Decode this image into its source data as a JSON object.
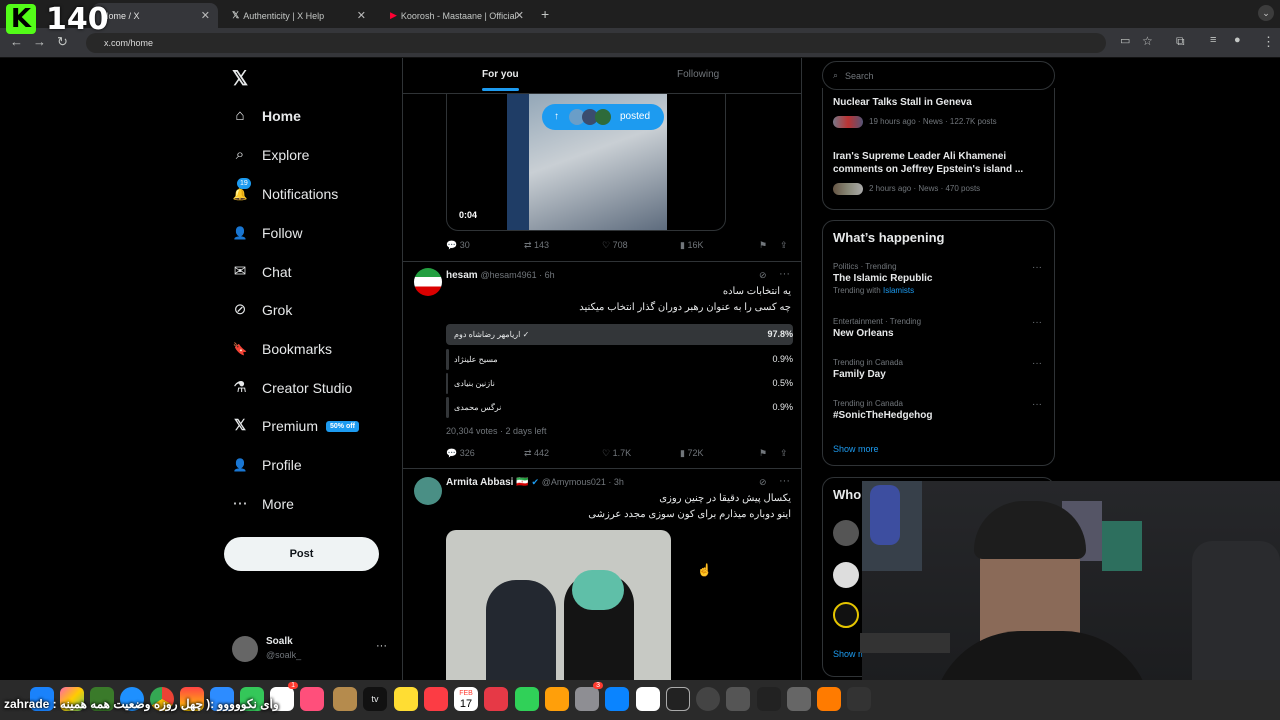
{
  "overlay": {
    "logo": "K",
    "viewers": "140"
  },
  "browser": {
    "tabs": [
      {
        "title": "Home / X",
        "active": true
      },
      {
        "title": "Authenticity | X Help",
        "active": false
      },
      {
        "title": "Koorosh - Mastaane | Official",
        "active": false
      }
    ],
    "new_tab": "+",
    "url": "x.com/home"
  },
  "sidebar": {
    "logo": "𝕏",
    "items": [
      {
        "label": "Home",
        "icon": "home-icon",
        "glyph": "⌂"
      },
      {
        "label": "Explore",
        "icon": "search-icon",
        "glyph": "⌕"
      },
      {
        "label": "Notifications",
        "icon": "bell-icon",
        "glyph": "🔔",
        "badge": "19"
      },
      {
        "label": "Follow",
        "icon": "person-plus-icon",
        "glyph": "👤"
      },
      {
        "label": "Chat",
        "icon": "mail-icon",
        "glyph": "✉"
      },
      {
        "label": "Grok",
        "icon": "grok-icon",
        "glyph": "⊘"
      },
      {
        "label": "Bookmarks",
        "icon": "bookmark-icon",
        "glyph": "🔖"
      },
      {
        "label": "Creator Studio",
        "icon": "flask-icon",
        "glyph": "⚗"
      },
      {
        "label": "Premium",
        "icon": "x-icon",
        "glyph": "𝕏",
        "badge": "50% off"
      },
      {
        "label": "Profile",
        "icon": "person-icon",
        "glyph": "👤"
      },
      {
        "label": "More",
        "icon": "more-circle-icon",
        "glyph": "⋯"
      }
    ],
    "post_button": "Post",
    "account": {
      "name": "Soalk",
      "handle": "@soalk_",
      "menu": "···"
    }
  },
  "feed": {
    "tabs": [
      "For you",
      "Following"
    ],
    "posted_pill": "posted",
    "video": {
      "duration": "0:04",
      "stats": {
        "replies": "30",
        "reposts": "143",
        "likes": "708",
        "views": "16K"
      }
    },
    "poll_post": {
      "name": "hesam",
      "handle": "@hesam4961 · 6h",
      "text1": "یه انتخابات ساده",
      "text2": "چه کسی را به عنوان رهبر دوران گذار انتخاب میکنید",
      "options": [
        {
          "label": "اریامهر رضاشاه دوم",
          "percent": "97.8%",
          "winner": true
        },
        {
          "label": "مسیح علینژاد",
          "percent": "0.9%"
        },
        {
          "label": "نازنین بنیادی",
          "percent": "0.5%"
        },
        {
          "label": "نرگس محمدی",
          "percent": "0.9%"
        }
      ],
      "poll_value": 0.978,
      "votes": "20,304 votes · 2 days left",
      "stats": {
        "replies": "326",
        "reposts": "442",
        "likes": "1.7K",
        "views": "72K"
      }
    },
    "photo_post": {
      "name": "Armita Abbasi 🇮🇷",
      "handle": "@Amymous021 · 3h",
      "text1": "یکسال پیش دقیقا در چنین روزی",
      "text2": "اینو دوباره میذارم برای کون سوزی مجدد عرزشی"
    }
  },
  "right": {
    "search_placeholder": "Search",
    "news": [
      {
        "title": "Nuclear Talks Stall in Geneva",
        "meta": "19 hours ago · News · 122.7K posts"
      },
      {
        "title": "Iran's Supreme Leader Ali Khamenei comments on Jeffrey Epstein's island ...",
        "meta": "2 hours ago · News · 470 posts"
      }
    ],
    "whats_happening": {
      "title": "What’s happening",
      "trends": [
        {
          "cat": "Politics · Trending",
          "name": "The Islamic Republic",
          "extra": "Trending with",
          "link": "Islamists"
        },
        {
          "cat": "Entertainment · Trending",
          "name": "New Orleans"
        },
        {
          "cat": "Trending in Canada",
          "name": "Family Day"
        },
        {
          "cat": "Trending in Canada",
          "name": "#SonicTheHedgehog"
        }
      ],
      "show_more": "Show more"
    },
    "who_to_follow": {
      "title": "Who",
      "show_more": "Show m"
    }
  },
  "caption": {
    "user": "zahrade :",
    "text": "وای نکووووو :( چهل روزه وضعیت همه همینه"
  },
  "dock": {
    "calendar_month": "FEB",
    "calendar_day": "17",
    "appletv": "tv",
    "badge": "3"
  }
}
